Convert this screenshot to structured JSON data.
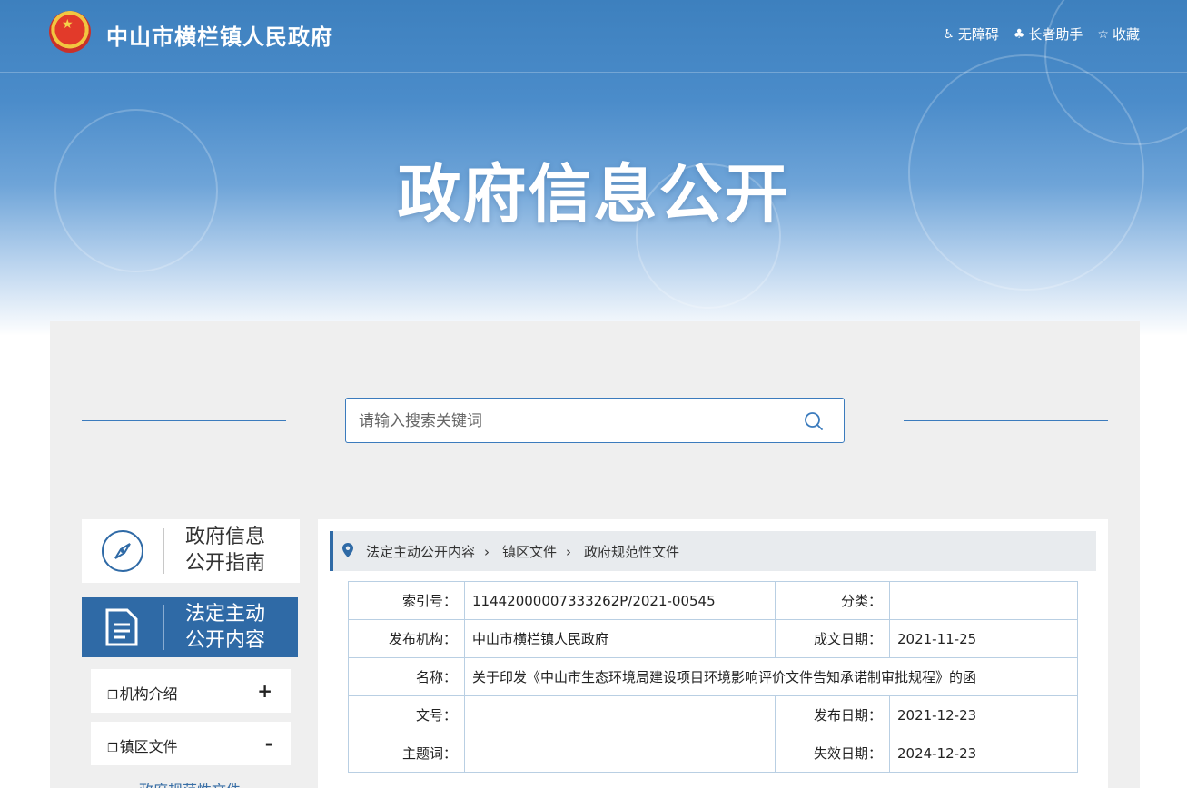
{
  "header": {
    "site_title": "中山市横栏镇人民政府",
    "hero_title": "政府信息公开",
    "links": [
      {
        "icon": "wheelchair-icon",
        "label": "无障碍"
      },
      {
        "icon": "elder-icon",
        "label": "长者助手"
      },
      {
        "icon": "star-icon",
        "label": "收藏"
      }
    ]
  },
  "search": {
    "placeholder": "请输入搜索关键词"
  },
  "sidebar": {
    "guide": {
      "line1": "政府信息",
      "line2": "公开指南"
    },
    "legal": {
      "line1": "法定主动",
      "line2": "公开内容"
    },
    "items": [
      {
        "label": "机构介绍",
        "toggle": "+"
      },
      {
        "label": "镇区文件",
        "toggle": "-"
      }
    ],
    "sub_item": "政府规范性文件"
  },
  "breadcrumb": [
    "法定主动公开内容",
    "镇区文件",
    "政府规范性文件"
  ],
  "meta": {
    "index_label": "索引号：",
    "index_value": "11442000007333262P/2021-00545",
    "category_label": "分类：",
    "category_value": "",
    "publisher_label": "发布机构：",
    "publisher_value": "中山市横栏镇人民政府",
    "created_label": "成文日期：",
    "created_value": "2021-11-25",
    "name_label": "名称：",
    "name_value": "关于印发《中山市生态环境局建设项目环境影响评价文件告知承诺制审批规程》的函",
    "docno_label": "文号：",
    "docno_value": "",
    "published_label": "发布日期：",
    "published_value": "2021-12-23",
    "keywords_label": "主题词：",
    "keywords_value": "",
    "expiry_label": "失效日期：",
    "expiry_value": "2024-12-23"
  },
  "colors": {
    "primary": "#2f6aa6",
    "panel_bg": "#efefef"
  }
}
